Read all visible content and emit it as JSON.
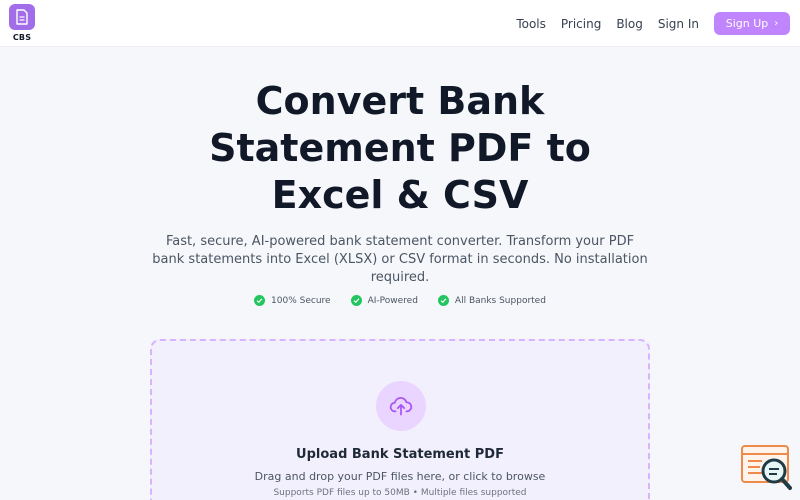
{
  "brand": {
    "name": "CBS",
    "logo_icon": "document-icon",
    "accent_color": "#a26de8"
  },
  "nav": {
    "links": [
      "Tools",
      "Pricing",
      "Blog",
      "Sign In"
    ],
    "signup_label": "Sign Up",
    "signup_color": "#c084fc"
  },
  "hero": {
    "title_lines": [
      "Convert Bank",
      "Statement PDF to",
      "Excel & CSV"
    ],
    "subtitle_lines": [
      "Fast, secure, AI-powered bank statement converter. Transform your PDF",
      "bank statements into Excel (XLSX) or CSV format in seconds. No installation",
      "required."
    ]
  },
  "features": [
    "100% Secure",
    "AI-Powered",
    "All Banks Supported"
  ],
  "upload": {
    "icon": "cloud-upload-icon",
    "title": "Upload Bank Statement PDF",
    "description": "Drag and drop your PDF files here, or click to browse",
    "note": "Supports PDF files up to 50MB • Multiple files supported",
    "border_color": "#d8b4fe"
  },
  "widget": {
    "icon": "search-widget-icon"
  }
}
